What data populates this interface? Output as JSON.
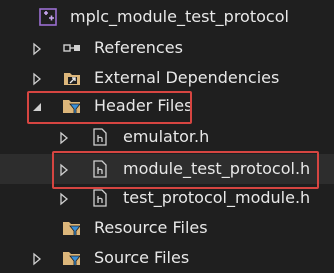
{
  "tree": {
    "project": {
      "label": "mplc_module_test_protocol",
      "icon": "cpp-project-icon"
    },
    "references": {
      "label": "References",
      "icon": "references-icon"
    },
    "external_dependencies": {
      "label": "External Dependencies",
      "icon": "external-dependencies-icon"
    },
    "header_files": {
      "label": "Header Files",
      "icon": "filter-folder-icon",
      "children": [
        {
          "label": "emulator.h",
          "icon": "header-file-icon"
        },
        {
          "label": "module_test_protocol.h",
          "icon": "header-file-icon"
        },
        {
          "label": "test_protocol_module.h",
          "icon": "header-file-icon"
        }
      ]
    },
    "resource_files": {
      "label": "Resource Files",
      "icon": "filter-folder-icon"
    },
    "source_files": {
      "label": "Source Files",
      "icon": "filter-folder-icon"
    }
  },
  "colors": {
    "background": "#1f1f1f",
    "text": "#e8e8e8",
    "highlight_border": "#d64541",
    "selected_row": "#2d2d2d",
    "folder": "#dcb67a",
    "filter": "#3b8fd6"
  }
}
